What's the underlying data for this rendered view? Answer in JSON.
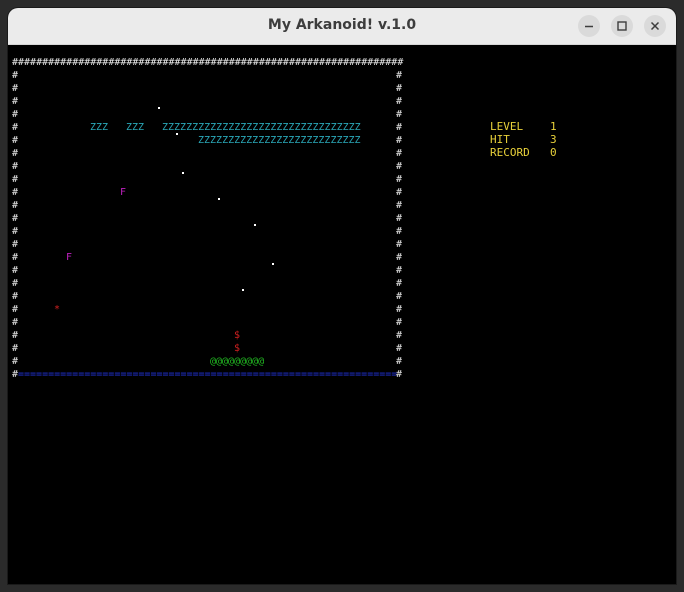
{
  "window": {
    "title": "My Arkanoid! v.1.0"
  },
  "titlebar_buttons": {
    "minimize_icon": "minimize-icon",
    "maximize_icon": "maximize-icon",
    "close_icon": "close-icon"
  },
  "field": {
    "border_char": "#",
    "floor_char": "=",
    "brick_char": "Z",
    "paddle_text": "@@@@@@@@@",
    "bonus_char": "F",
    "hazard_char": "*",
    "drop_char": "$",
    "colors": {
      "border": "#e8e8e8",
      "floor": "#2233dd",
      "brick": "#2aa8b8",
      "bonus": "#c020c0",
      "hazard": "#d02020",
      "paddle": "#22bb22",
      "hud": "#e8d13a"
    }
  },
  "hud": {
    "level_label": "LEVEL",
    "level_value": "1",
    "hit_label": "HIT",
    "hit_value": "3",
    "record_label": "RECORD",
    "record_value": "0"
  }
}
